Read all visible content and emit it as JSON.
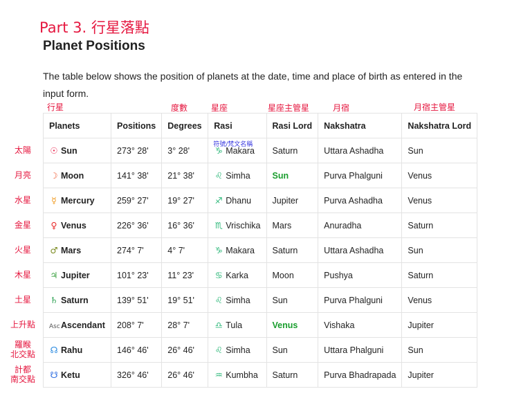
{
  "part_title": "Part 3. 行星落點",
  "heading": "Planet Positions",
  "intro": "The table below shows the position of planets at the date, time and place of birth as entered in the input form.",
  "annotations": {
    "planets": "行星",
    "degrees": "度數",
    "rasi": "星座",
    "rasi_lord": "星座主管星",
    "nakshatra": "月宿",
    "nakshatra_lord": "月宿主管星",
    "rasi_note": "符號/梵文名稱"
  },
  "columns": [
    "Planets",
    "Positions",
    "Degrees",
    "Rasi",
    "Rasi Lord",
    "Nakshatra",
    "Nakshatra Lord"
  ],
  "rows": [
    {
      "cn": "太陽",
      "glyph": "☉",
      "gc": "#e8204a",
      "planet": "Sun",
      "pos": "273° 28'",
      "deg": "3° 28'",
      "rg": "♑",
      "rasi": "Makara",
      "lord": "Saturn",
      "lh": false,
      "nak": "Uttara Ashadha",
      "nl": "Sun"
    },
    {
      "cn": "月亮",
      "glyph": "☽",
      "gc": "#f0603a",
      "planet": "Moon",
      "pos": "141° 38'",
      "deg": "21° 38'",
      "rg": "♌",
      "rasi": "Simha",
      "lord": "Sun",
      "lh": true,
      "nak": "Purva Phalguni",
      "nl": "Venus"
    },
    {
      "cn": "水星",
      "glyph": "☿",
      "gc": "#f09a20",
      "planet": "Mercury",
      "pos": "259° 27'",
      "deg": "19° 27'",
      "rg": "♐",
      "rasi": "Dhanu",
      "lord": "Jupiter",
      "lh": false,
      "nak": "Purva Ashadha",
      "nl": "Venus"
    },
    {
      "cn": "金星",
      "glyph": "♀",
      "gc": "#e82a2a",
      "planet": "Venus",
      "pos": "226° 36'",
      "deg": "16° 36'",
      "rg": "♏",
      "rasi": "Vrischika",
      "lord": "Mars",
      "lh": false,
      "nak": "Anuradha",
      "nl": "Saturn"
    },
    {
      "cn": "火星",
      "glyph": "♂",
      "gc": "#7a8a20",
      "planet": "Mars",
      "pos": "274° 7'",
      "deg": "4° 7'",
      "rg": "♑",
      "rasi": "Makara",
      "lord": "Saturn",
      "lh": false,
      "nak": "Uttara Ashadha",
      "nl": "Sun"
    },
    {
      "cn": "木星",
      "glyph": "♃",
      "gc": "#3aa040",
      "planet": "Jupiter",
      "pos": "101° 23'",
      "deg": "11° 23'",
      "rg": "♋",
      "rasi": "Karka",
      "lord": "Moon",
      "lh": false,
      "nak": "Pushya",
      "nl": "Saturn"
    },
    {
      "cn": "土星",
      "glyph": "♄",
      "gc": "#2aa050",
      "planet": "Saturn",
      "pos": "139° 51'",
      "deg": "19° 51'",
      "rg": "♌",
      "rasi": "Simha",
      "lord": "Sun",
      "lh": false,
      "nak": "Purva Phalguni",
      "nl": "Venus"
    },
    {
      "cn": "上升點",
      "glyph": "Asc",
      "gc": "#555555",
      "planet": "Ascendant",
      "pos": "208° 7'",
      "deg": "28° 7'",
      "rg": "♎",
      "rasi": "Tula",
      "lord": "Venus",
      "lh": true,
      "nak": "Vishaka",
      "nl": "Jupiter"
    },
    {
      "cn": "羅睺 北交點",
      "glyph": "☊",
      "gc": "#2a8ae0",
      "planet": "Rahu",
      "pos": "146° 46'",
      "deg": "26° 46'",
      "rg": "♌",
      "rasi": "Simha",
      "lord": "Sun",
      "lh": false,
      "nak": "Uttara Phalguni",
      "nl": "Sun"
    },
    {
      "cn": "計都 南交點",
      "glyph": "☋",
      "gc": "#2a6ae0",
      "planet": "Ketu",
      "pos": "326° 46'",
      "deg": "26° 46'",
      "rg": "♒",
      "rasi": "Kumbha",
      "lord": "Saturn",
      "lh": false,
      "nak": "Purva Bhadrapada",
      "nl": "Jupiter"
    }
  ],
  "colors": {
    "accent": "#e5173f",
    "highlight": "#1a9e2e",
    "sign": "#2eb87a"
  }
}
